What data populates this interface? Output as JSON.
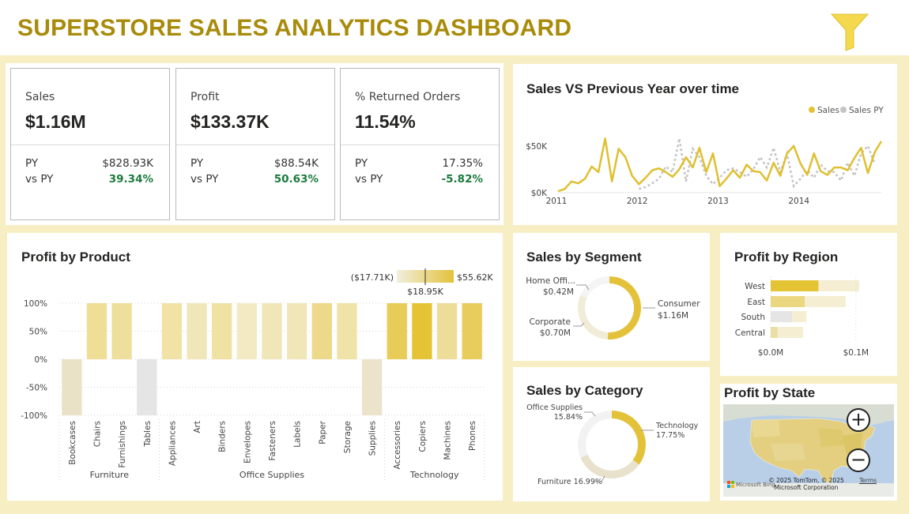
{
  "header": {
    "title": "SUPERSTORE SALES ANALYTICS DASHBOARD",
    "filter_icon": "filter-funnel-icon"
  },
  "colors": {
    "accent": "#e3c23a",
    "title": "#a88b0a",
    "background": "#f8eec4",
    "positive": "#1a7a3c",
    "py_line": "#c4c4c4"
  },
  "kpis": [
    {
      "label": "Sales",
      "value": "$1.16M",
      "py_label": "PY",
      "py_value": "$828.93K",
      "vs_label": "vs PY",
      "vs_value": "39.34%"
    },
    {
      "label": "Profit",
      "value": "$133.37K",
      "py_label": "PY",
      "py_value": "$88.54K",
      "vs_label": "vs PY",
      "vs_value": "50.63%"
    },
    {
      "label": "% Returned Orders",
      "value": "11.54%",
      "py_label": "PY",
      "py_value": "17.35%",
      "vs_label": "vs PY",
      "vs_value": "-5.82%"
    }
  ],
  "sales_vs_py": {
    "title": "Sales VS Previous Year over time",
    "legend": [
      "Sales",
      "Sales PY"
    ],
    "chart_data": {
      "type": "line",
      "x_ticks": [
        "2011",
        "2012",
        "2013",
        "2014"
      ],
      "y_ticks": [
        "$0K",
        "$50K"
      ],
      "ylim": [
        0,
        60000
      ],
      "series": [
        {
          "name": "Sales",
          "values": [
            1500,
            4000,
            12000,
            10000,
            15000,
            28000,
            22000,
            58000,
            12000,
            47000,
            38000,
            18000,
            9000,
            16000,
            24000,
            26000,
            22000,
            17000,
            25000,
            38000,
            27000,
            48000,
            22000,
            42000,
            7000,
            15000,
            24000,
            16000,
            30000,
            23000,
            22000,
            13000,
            32000,
            18000,
            42000,
            50000,
            31000,
            19000,
            42000,
            23000,
            19000,
            27000,
            27000,
            24000,
            37000,
            48000,
            21000,
            43000,
            55000
          ]
        },
        {
          "name": "Sales PY",
          "values": [
            null,
            null,
            null,
            null,
            null,
            null,
            null,
            null,
            null,
            null,
            null,
            null,
            4000,
            6000,
            10000,
            15000,
            28000,
            22000,
            58000,
            12000,
            47000,
            38000,
            18000,
            9000,
            16000,
            24000,
            26000,
            22000,
            17000,
            25000,
            38000,
            27000,
            48000,
            22000,
            42000,
            7000,
            15000,
            24000,
            16000,
            30000,
            23000,
            22000,
            13000,
            32000,
            18000,
            42000,
            50000,
            31000,
            null
          ]
        }
      ]
    }
  },
  "profit_by_product": {
    "title": "Profit by Product",
    "gradient_legend": {
      "min": "($17.71K)",
      "max": "$55.62K",
      "mid": "$18.95K"
    },
    "chart_data": {
      "type": "bar",
      "y_ticks": [
        "100%",
        "50%",
        "0%",
        "-50%",
        "-100%"
      ],
      "ylim": [
        -100,
        100
      ],
      "groups": [
        {
          "name": "Furniture",
          "categories": [
            "Bookcases",
            "Chairs",
            "Furnishings",
            "Tables"
          ]
        },
        {
          "name": "Office Supplies",
          "categories": [
            "Appliances",
            "Art",
            "Binders",
            "Envelopes",
            "Fasteners",
            "Labels",
            "Paper",
            "Storage",
            "Supplies"
          ]
        },
        {
          "name": "Technology",
          "categories": [
            "Accessories",
            "Copiers",
            "Machines",
            "Phones"
          ]
        }
      ],
      "values": [
        -100,
        100,
        100,
        -100,
        100,
        100,
        100,
        100,
        100,
        100,
        100,
        100,
        -100,
        100,
        100,
        100,
        100
      ],
      "colors": [
        "#e9e2c6",
        "#efde96",
        "#efdf9c",
        "#e5e5e5",
        "#f1e3a6",
        "#f1e6b8",
        "#f0e2a3",
        "#f3e9c3",
        "#f1e6b8",
        "#f1e6b8",
        "#eed98b",
        "#f0e3a8",
        "#ebe4ca",
        "#e7cc58",
        "#e4c435",
        "#eedd98",
        "#e8cc5c"
      ]
    }
  },
  "sales_by_segment": {
    "title": "Sales by Segment",
    "chart_data": {
      "type": "pie",
      "slices": [
        {
          "label": "Consumer",
          "value_label": "$1.16M",
          "value": 1.16,
          "color": "#e3c23a"
        },
        {
          "label": "Corporate",
          "value_label": "$0.70M",
          "value": 0.7,
          "color": "#f1ecd8"
        },
        {
          "label": "Home Offi...",
          "value_label": "$0.42M",
          "value": 0.42,
          "color": "#f4f4f4"
        }
      ]
    }
  },
  "profit_by_region": {
    "title": "Profit by Region",
    "chart_data": {
      "type": "bar",
      "categories": [
        "West",
        "East",
        "South",
        "Central"
      ],
      "values": [
        0.056,
        0.04,
        0.025,
        0.008
      ],
      "py_values": [
        0.104,
        0.088,
        0.042,
        0.038
      ],
      "colors": [
        "#e4c435",
        "#ead780",
        "#e5e5e5",
        "#e9dfa4"
      ],
      "x_ticks": [
        "$0.0M",
        "$0.1M"
      ],
      "xlim": [
        0,
        0.115
      ]
    }
  },
  "sales_by_category": {
    "title": "Sales by Category",
    "chart_data": {
      "type": "pie",
      "slices": [
        {
          "label": "Technology",
          "value_label": "17.75%",
          "value": 17.75,
          "color": "#e3c23a"
        },
        {
          "label": "Furniture",
          "value_label": "16.99%",
          "value": 16.99,
          "color": "#e8e2cc"
        },
        {
          "label": "Office Supplies",
          "value_label": "15.84%",
          "value": 15.84,
          "color": "#f2f2f2"
        }
      ]
    }
  },
  "profit_by_state": {
    "title": "Profit by State",
    "zoom_in": "+",
    "zoom_out": "−",
    "attribution": "© 2025 TomTom, © 2025 Microsoft Corporation",
    "terms": "Terms",
    "bing": "Microsoft Bing"
  }
}
